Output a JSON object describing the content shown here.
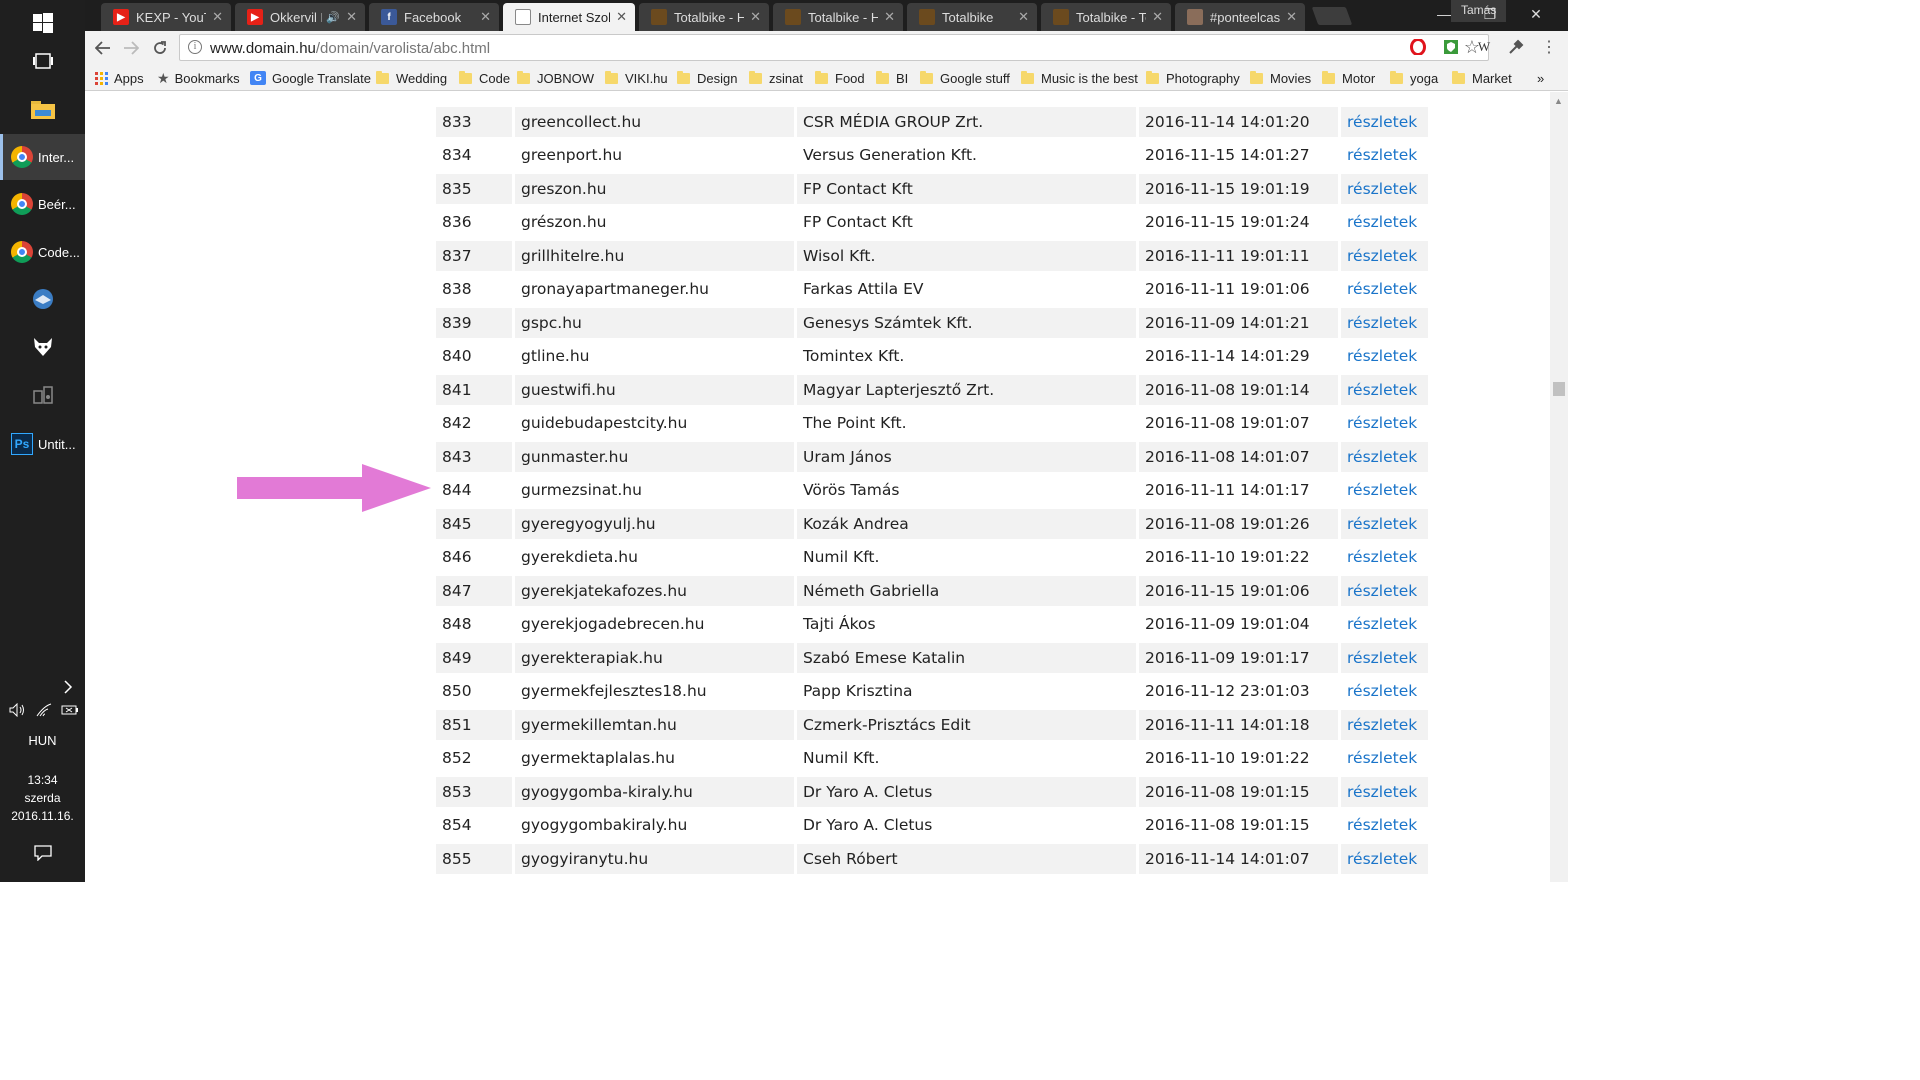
{
  "taskbar": {
    "apps": [
      {
        "label": "Inter...",
        "icon": "chrome-icon",
        "active": true
      },
      {
        "label": "Beér...",
        "icon": "chrome-icon",
        "active": false
      },
      {
        "label": "Code...",
        "icon": "chrome-icon",
        "active": false
      },
      {
        "label": "Untit...",
        "icon": "photoshop-icon",
        "active": false
      }
    ],
    "language": "HUN",
    "time": "13:34",
    "weekday": "szerda",
    "date": "2016.11.16."
  },
  "browser": {
    "tabs": [
      {
        "title": "KEXP - YouTu",
        "icon": "youtube-icon"
      },
      {
        "title": "Okkervil R",
        "icon": "youtube-icon"
      },
      {
        "title": "Facebook",
        "icon": "facebook-icon"
      },
      {
        "title": "Internet Szolg",
        "icon": "document-icon",
        "active": true
      },
      {
        "title": "Totalbike - H",
        "icon": "totalbike-icon"
      },
      {
        "title": "Totalbike - H",
        "icon": "totalbike-icon"
      },
      {
        "title": "Totalbike",
        "icon": "totalbike-icon"
      },
      {
        "title": "Totalbike - Te",
        "icon": "totalbike-icon"
      },
      {
        "title": "#ponteelcasc",
        "icon": "image-icon"
      }
    ],
    "profile_name": "Tamás",
    "url_host": "www.domain.hu",
    "url_path": "/domain/varolista/abc.html",
    "bookmarks": {
      "apps_label": "Apps",
      "bookmarks_label": "Bookmarks",
      "translate_label": "Google Translate",
      "folders": [
        "Wedding",
        "Code",
        "JOBNOW",
        "VIKI.hu",
        "Design",
        "zsinat",
        "Food",
        "BI",
        "Google stuff",
        "Music is the best",
        "Photography",
        "Movies",
        "Motor",
        "yoga",
        "Market"
      ],
      "overflow": "»"
    }
  },
  "table": {
    "link_label": "részletek",
    "rows": [
      {
        "num": "833",
        "domain": "greencollect.hu",
        "owner": "CSR MÉDIA GROUP Zrt.",
        "date": "2016-11-14 14:01:20"
      },
      {
        "num": "834",
        "domain": "greenport.hu",
        "owner": "Versus Generation Kft.",
        "date": "2016-11-15 14:01:27"
      },
      {
        "num": "835",
        "domain": "greszon.hu",
        "owner": "FP Contact Kft",
        "date": "2016-11-15 19:01:19"
      },
      {
        "num": "836",
        "domain": "grészon.hu",
        "owner": "FP Contact Kft",
        "date": "2016-11-15 19:01:24"
      },
      {
        "num": "837",
        "domain": "grillhitelre.hu",
        "owner": "Wisol Kft.",
        "date": "2016-11-11 19:01:11"
      },
      {
        "num": "838",
        "domain": "gronayapartmaneger.hu",
        "owner": "Farkas Attila EV",
        "date": "2016-11-11 19:01:06"
      },
      {
        "num": "839",
        "domain": "gspc.hu",
        "owner": "Genesys Számtek Kft.",
        "date": "2016-11-09 14:01:21"
      },
      {
        "num": "840",
        "domain": "gtline.hu",
        "owner": "Tomintex Kft.",
        "date": "2016-11-14 14:01:29"
      },
      {
        "num": "841",
        "domain": "guestwifi.hu",
        "owner": "Magyar Lapterjesztő Zrt.",
        "date": "2016-11-08 19:01:14"
      },
      {
        "num": "842",
        "domain": "guidebudapestcity.hu",
        "owner": "The Point Kft.",
        "date": "2016-11-08 19:01:07"
      },
      {
        "num": "843",
        "domain": "gunmaster.hu",
        "owner": "Uram János",
        "date": "2016-11-08 14:01:07"
      },
      {
        "num": "844",
        "domain": "gurmezsinat.hu",
        "owner": "Vörös Tamás",
        "date": "2016-11-11 14:01:17"
      },
      {
        "num": "845",
        "domain": "gyeregyogyulj.hu",
        "owner": "Kozák Andrea",
        "date": "2016-11-08 19:01:26"
      },
      {
        "num": "846",
        "domain": "gyerekdieta.hu",
        "owner": "Numil Kft.",
        "date": "2016-11-10 19:01:22"
      },
      {
        "num": "847",
        "domain": "gyerekjatekafozes.hu",
        "owner": "Németh Gabriella",
        "date": "2016-11-15 19:01:06"
      },
      {
        "num": "848",
        "domain": "gyerekjogadebrecen.hu",
        "owner": "Tajti Ákos",
        "date": "2016-11-09 19:01:04"
      },
      {
        "num": "849",
        "domain": "gyerekterapiak.hu",
        "owner": "Szabó Emese Katalin",
        "date": "2016-11-09 19:01:17"
      },
      {
        "num": "850",
        "domain": "gyermekfejlesztes18.hu",
        "owner": "Papp Krisztina",
        "date": "2016-11-12 23:01:03"
      },
      {
        "num": "851",
        "domain": "gyermekillemtan.hu",
        "owner": "Czmerk-Prisztács Edit",
        "date": "2016-11-11 14:01:18"
      },
      {
        "num": "852",
        "domain": "gyermektaplalas.hu",
        "owner": "Numil Kft.",
        "date": "2016-11-10 19:01:22"
      },
      {
        "num": "853",
        "domain": "gyogygomba-kiraly.hu",
        "owner": "Dr Yaro A. Cletus",
        "date": "2016-11-08 19:01:15"
      },
      {
        "num": "854",
        "domain": "gyogygombakiraly.hu",
        "owner": "Dr Yaro A. Cletus",
        "date": "2016-11-08 19:01:15"
      },
      {
        "num": "855",
        "domain": "gyogyiranytu.hu",
        "owner": "Cseh Róbert",
        "date": "2016-11-14 14:01:07"
      }
    ]
  },
  "colors": {
    "link": "#1a74c9",
    "arrow": "#e27ad6",
    "row_shade": "#f2f2f2"
  }
}
